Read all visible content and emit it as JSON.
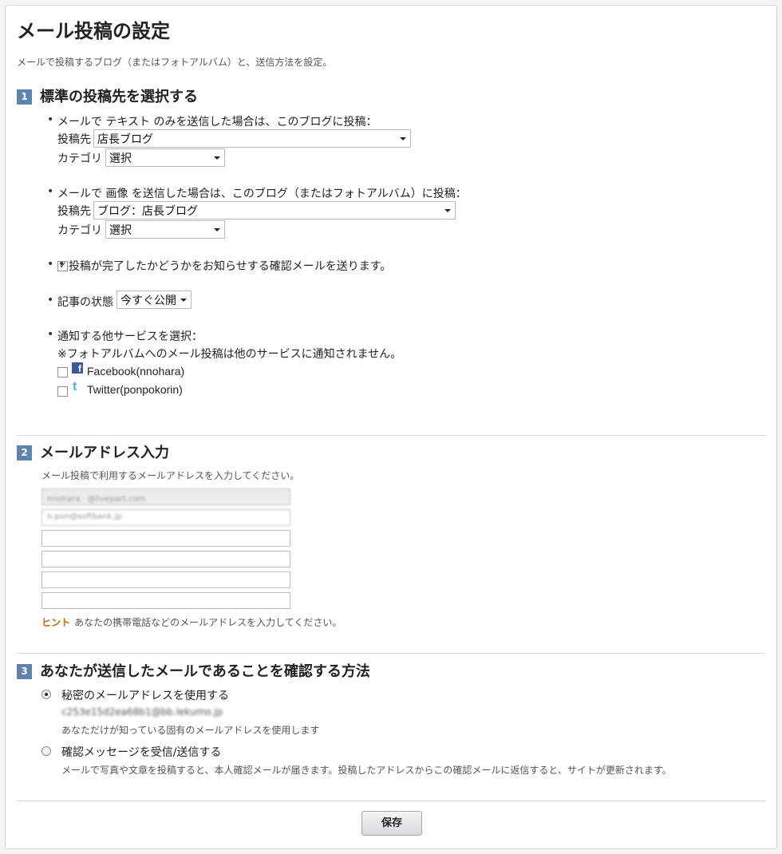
{
  "page": {
    "title": "メール投稿の設定",
    "description": "メールで投稿するブログ（またはフォトアルバム）と、送信方法を設定。"
  },
  "section1": {
    "number": "1",
    "title": "標準の投稿先を選択する",
    "text_rule": {
      "prefix": "メールで",
      "keyword": "テキスト",
      "suffix": "のみを送信した場合は、このブログに投稿：",
      "dest_label": "投稿先",
      "dest_value": "店長ブログ",
      "category_label": "カテゴリ",
      "category_value": "選択"
    },
    "image_rule": {
      "prefix": "メールで",
      "keyword": "画像",
      "suffix": "を送信した場合は、このブログ（またはフォトアルバム）に投稿：",
      "dest_label": "投稿先",
      "dest_value": "ブログ：店長ブログ",
      "category_label": "カテゴリ",
      "category_value": "選択"
    },
    "confirm_mail": {
      "label": "投稿が完了したかどうかをお知らせする確認メールを送ります。",
      "checked": true
    },
    "article_state": {
      "label": "記事の状態",
      "value": "今すぐ公開"
    },
    "notify": {
      "label": "通知する他サービスを選択：",
      "note": "※フォトアルバムへのメール投稿は他のサービスに通知されません。",
      "services": [
        {
          "icon": "facebook-icon",
          "name": "Facebook(nnohara)",
          "checked": false
        },
        {
          "icon": "twitter-icon",
          "name": "Twitter(ponpokorin)",
          "checked": false
        }
      ]
    }
  },
  "section2": {
    "number": "2",
    "title": "メールアドレス入力",
    "description": "メール投稿で利用するメールアドレスを入力してください。",
    "addresses": [
      "nnoharaㅤ@livepart.com",
      "n.pon@softbank.jp",
      "",
      "",
      "",
      ""
    ],
    "hint_label": "ヒント",
    "hint_text": "あなたの携帯電話などのメールアドレスを入力してください。"
  },
  "section3": {
    "number": "3",
    "title": "あなたが送信したメールであることを確認する方法",
    "options": [
      {
        "label": "秘密のメールアドレスを使用する",
        "secret": "c253e15d2ea68b1@bb.lekumo.jp",
        "description": "あなただけが知っている固有のメールアドレスを使用します",
        "selected": true
      },
      {
        "label": "確認メッセージを受信/送信する",
        "description": "メールで写真や文章を投稿すると、本人確認メールが届きます。投稿したアドレスからこの確認メールに返信すると、サイトが更新されます。",
        "selected": false
      }
    ]
  },
  "footer": {
    "save_label": "保存"
  },
  "colors": {
    "section_number_bg": "#5b84b1",
    "hint": "#cc6600",
    "facebook": "#3b5998",
    "twitter": "#39b7e8"
  }
}
